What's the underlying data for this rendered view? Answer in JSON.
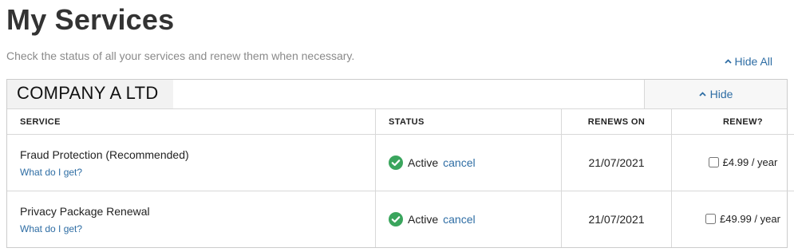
{
  "header": {
    "title": "My Services",
    "subtitle": "Check the status of all your services and renew them when necessary.",
    "hide_all_label": "Hide All"
  },
  "company": {
    "name": "COMPANY A LTD",
    "hide_label": "Hide"
  },
  "table": {
    "columns": [
      "SERVICE",
      "STATUS",
      "RENEWS ON",
      "RENEW?"
    ],
    "rows": [
      {
        "service": "Fraud Protection (Recommended)",
        "info_link": "What do I get?",
        "status": "Active",
        "cancel_label": "cancel",
        "renews_on": "21/07/2021",
        "renew_price": "£4.99 / year",
        "renew_checked": false
      },
      {
        "service": "Privacy Package Renewal",
        "info_link": "What do I get?",
        "status": "Active",
        "cancel_label": "cancel",
        "renews_on": "21/07/2021",
        "renew_price": "£49.99 / year",
        "renew_checked": false
      }
    ]
  },
  "icons": {
    "status_icon": "check-circle-icon",
    "collapse_icon": "chevron-up-icon"
  },
  "colors": {
    "link": "#2e6da4",
    "status_ok": "#3aa55d",
    "title": "#333333"
  }
}
